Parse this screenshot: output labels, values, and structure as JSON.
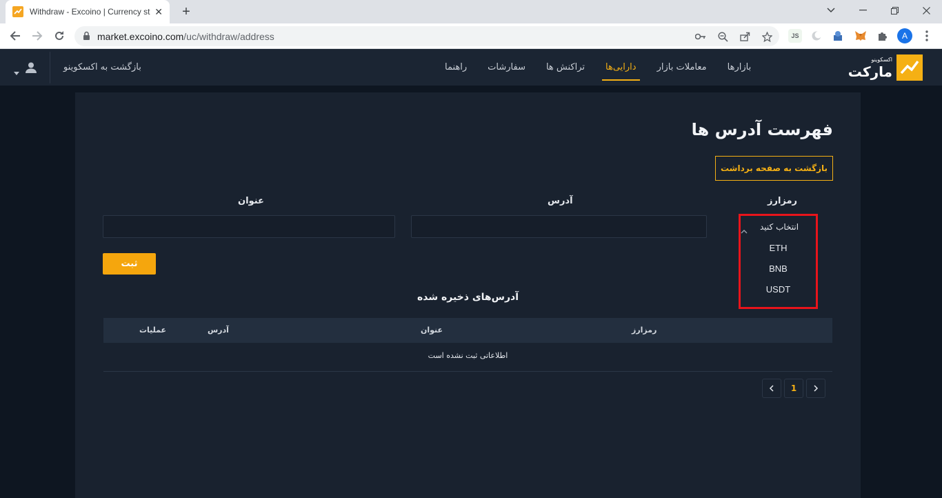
{
  "browser": {
    "tab_title": "Withdraw - Excoino | Currency st",
    "url_host": "market.excoino.com",
    "url_path": "/uc/withdraw/address",
    "profile_initial": "A",
    "ext_js": "JS"
  },
  "header": {
    "logo_small": "اکسکوینو",
    "logo_big": "مارکت",
    "nav": [
      {
        "label": "بازارها",
        "active": false
      },
      {
        "label": "معاملات بازار",
        "active": false
      },
      {
        "label": "دارایی‌ها",
        "active": true
      },
      {
        "label": "تراکنش ها",
        "active": false
      },
      {
        "label": "سفارشات",
        "active": false
      },
      {
        "label": "راهنما",
        "active": false
      }
    ],
    "back_link": "بازگشت به اکسکوینو"
  },
  "page": {
    "title": "فهرست آدرس ها",
    "back_withdraw": "بازگشت به صفحه برداشت",
    "form": {
      "currency_label": "رمزارز",
      "address_label": "آدرس",
      "title_label": "عنوان",
      "address_value": "",
      "title_value": "",
      "select_placeholder": "انتخاب کنید",
      "options": [
        "ETH",
        "BNB",
        "USDT"
      ],
      "submit": "ثبت"
    },
    "saved_title": "آدرس‌های ذخیره شده",
    "table": {
      "columns": [
        "رمزارز",
        "عنوان",
        "آدرس",
        "عملیات"
      ],
      "empty": "اطلاعاتی ثبت نشده است"
    },
    "pager": {
      "current": "1"
    }
  },
  "colors": {
    "accent": "#f5b014",
    "highlight_border": "#e8141b",
    "panel": "#19222f",
    "header": "#1b2533"
  }
}
